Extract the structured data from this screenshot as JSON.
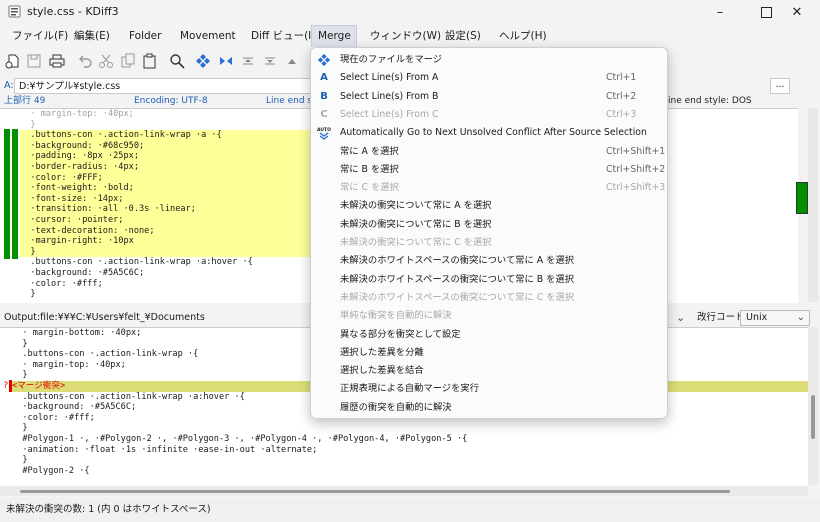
{
  "window": {
    "title": "style.css - KDiff3"
  },
  "menubar": {
    "file": "ファイル(F)",
    "edit": "編集(E)",
    "folder": "Folder",
    "movement": "Movement",
    "diff_view": "Diff ビュー(I)",
    "merge": "Merge",
    "window": "ウィンドウ(W)",
    "settings": "設定(S)",
    "help": "ヘルプ(H)"
  },
  "pane_a": {
    "label": "A:",
    "path": "D:¥サンプル¥style.css",
    "browse": "...",
    "top_line": "上部行 49",
    "encoding": "Encoding: UTF-8",
    "line_end": "Line end st",
    "lines": [
      "  · margin-top: ·40px;",
      "  }",
      "  .buttons-con ·.action-link-wrap ·a ·{",
      "  ·background: ·#68c950;",
      "  ·padding: ·8px ·25px;",
      "  ·border-radius: ·4px;",
      "  ·color: ·#FFF;",
      "  ·font-weight: ·bold;",
      "  ·font-size: ·14px;",
      "  ·transition: ·all ·0.3s ·linear;",
      "  ·cursor: ·pointer;",
      "  ·text-decoration: ·none;",
      "  ·margin-right: ·10px",
      "  }",
      "  .buttons-con ·.action-link-wrap ·a:hover ·{",
      "  ·background: ·#5A5C6C;",
      "  ·color: ·#fff;",
      "  }"
    ]
  },
  "pane_right": {
    "line_end": "ine end style: DOS"
  },
  "output": {
    "label": "Output:",
    "path": "file:¥¥¥C:¥Users¥felt_¥Documents",
    "line_end_label": "改行コード:",
    "line_end_value": "Unix",
    "conflict_marker": "?",
    "conflict_text": "<マージ衝突>",
    "lines_before": [
      "  · margin-bottom: ·40px;",
      "  }",
      "  .buttons-con ·.action-link-wrap ·{",
      "  · margin-top: ·40px;",
      "  }"
    ],
    "lines_after": [
      "  .buttons-con ·.action-link-wrap ·a:hover ·{",
      "  ·background: ·#5A5C6C;",
      "  ·color: ·#fff;",
      "  }",
      "",
      "  #Polygon-1 ·, ·#Polygon-2 ·, ·#Polygon-3 ·, ·#Polygon-4 ·, ·#Polygon-4, ·#Polygon-5 ·{",
      "  ·animation: ·float ·1s ·infinite ·ease-in-out ·alternate;",
      "  }",
      "  #Polygon-2 ·{"
    ]
  },
  "merge_menu": {
    "items": [
      {
        "label": "現在のファイルをマージ",
        "shortcut": "",
        "icon": "merge-current-icon",
        "disabled": false
      },
      {
        "label": "Select Line(s) From A",
        "shortcut": "Ctrl+1",
        "icon": "select-a-icon",
        "disabled": false
      },
      {
        "label": "Select Line(s) From B",
        "shortcut": "Ctrl+2",
        "icon": "select-b-icon",
        "disabled": false
      },
      {
        "label": "Select Line(s) From C",
        "shortcut": "Ctrl+3",
        "icon": "select-c-icon",
        "disabled": true
      },
      {
        "label": "Automatically Go to Next Unsolved Conflict After Source Selection",
        "shortcut": "",
        "icon": "auto-next-icon",
        "disabled": false
      },
      {
        "label": "常に A を選択",
        "shortcut": "Ctrl+Shift+1",
        "icon": "",
        "disabled": false
      },
      {
        "label": "常に B を選択",
        "shortcut": "Ctrl+Shift+2",
        "icon": "",
        "disabled": false
      },
      {
        "label": "常に C を選択",
        "shortcut": "Ctrl+Shift+3",
        "icon": "",
        "disabled": true
      },
      {
        "label": "未解決の衝突について常に A を選択",
        "shortcut": "",
        "icon": "",
        "disabled": false
      },
      {
        "label": "未解決の衝突について常に B を選択",
        "shortcut": "",
        "icon": "",
        "disabled": false
      },
      {
        "label": "未解決の衝突について常に C を選択",
        "shortcut": "",
        "icon": "",
        "disabled": true
      },
      {
        "label": "未解決のホワイトスペースの衝突について常に A を選択",
        "shortcut": "",
        "icon": "",
        "disabled": false
      },
      {
        "label": "未解決のホワイトスペースの衝突について常に B を選択",
        "shortcut": "",
        "icon": "",
        "disabled": false
      },
      {
        "label": "未解決のホワイトスペースの衝突について常に C を選択",
        "shortcut": "",
        "icon": "",
        "disabled": true
      },
      {
        "label": "単純な衝突を自動的に解決",
        "shortcut": "",
        "icon": "",
        "disabled": true
      },
      {
        "label": "異なる部分を衝突として設定",
        "shortcut": "",
        "icon": "",
        "disabled": false
      },
      {
        "label": "選択した差異を分離",
        "shortcut": "",
        "icon": "",
        "disabled": false
      },
      {
        "label": "選択した差異を結合",
        "shortcut": "",
        "icon": "",
        "disabled": false
      },
      {
        "label": "正規表現による自動マージを実行",
        "shortcut": "",
        "icon": "",
        "disabled": false
      },
      {
        "label": "履歴の衝突を自動的に解決",
        "shortcut": "",
        "icon": "",
        "disabled": false
      }
    ]
  },
  "status": {
    "text": "未解決の衝突の数: 1 (内 0 はホワイトスペース)"
  },
  "colors": {
    "diff_bar": "#009000",
    "changed_bg": "#ffff99",
    "merge_conflict_bg": "#dddd77",
    "encoding_text": "#1a5fb4",
    "conflict_text": "#e00000"
  }
}
